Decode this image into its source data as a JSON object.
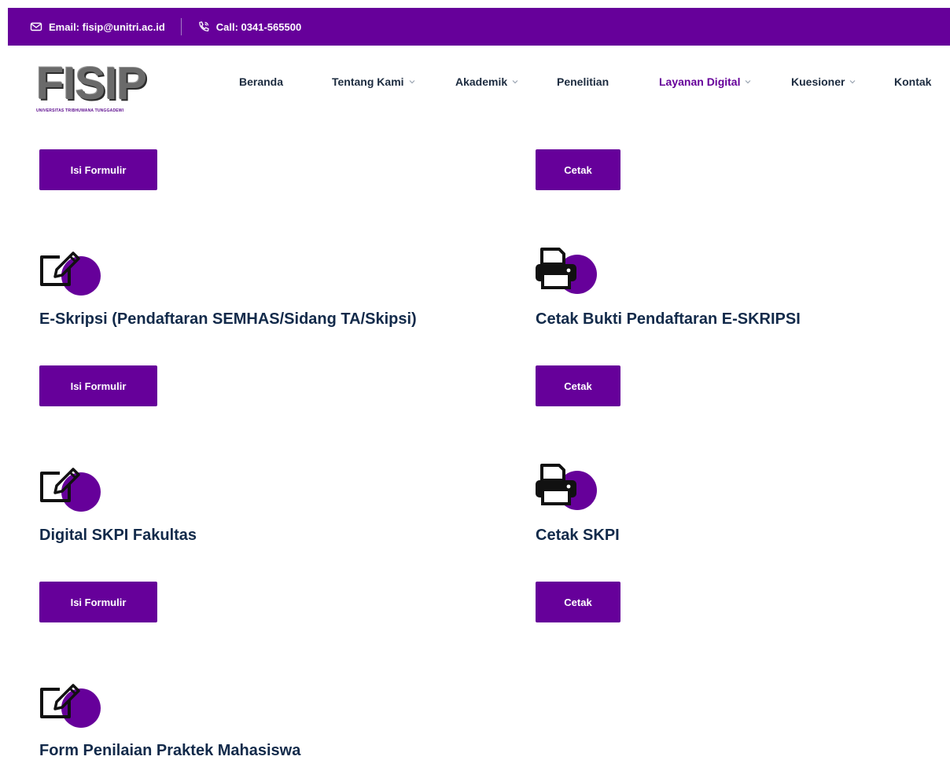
{
  "topbar": {
    "email": "Email: fisip@unitri.ac.id",
    "call": "Call: 0341-565500",
    "email_icon": "envelope-icon",
    "call_icon": "phone-icon"
  },
  "logo": {
    "word": "FISIP",
    "tagline": "UNIVERSITAS TRIBHUWANA TUNGGADEWI"
  },
  "nav": {
    "home": "Beranda",
    "about": "Tentang Kami",
    "academic": "Akademik",
    "research": "Penelitian",
    "digital": "Layanan Digital",
    "survey": "Kuesioner",
    "contact": "Kontak"
  },
  "sections": {
    "row0": {
      "form_button": "Isi Formulir",
      "print_button": "Cetak"
    },
    "row1": {
      "form_title": "E-Skripsi (Pendaftaran SEMHAS/Sidang TA/Skipsi)",
      "print_title": "Cetak Bukti Pendaftaran E-SKRIPSI",
      "form_button": "Isi Formulir",
      "print_button": "Cetak"
    },
    "row2": {
      "form_title": "Digital SKPI Fakultas",
      "print_title": "Cetak SKPI",
      "form_button": "Isi Formulir",
      "print_button": "Cetak"
    },
    "row3": {
      "form_title": "Form Penilaian Praktek Mahasiswa"
    }
  },
  "colors": {
    "accent": "#66009a",
    "heading": "#122a4a",
    "white": "#ffffff"
  }
}
